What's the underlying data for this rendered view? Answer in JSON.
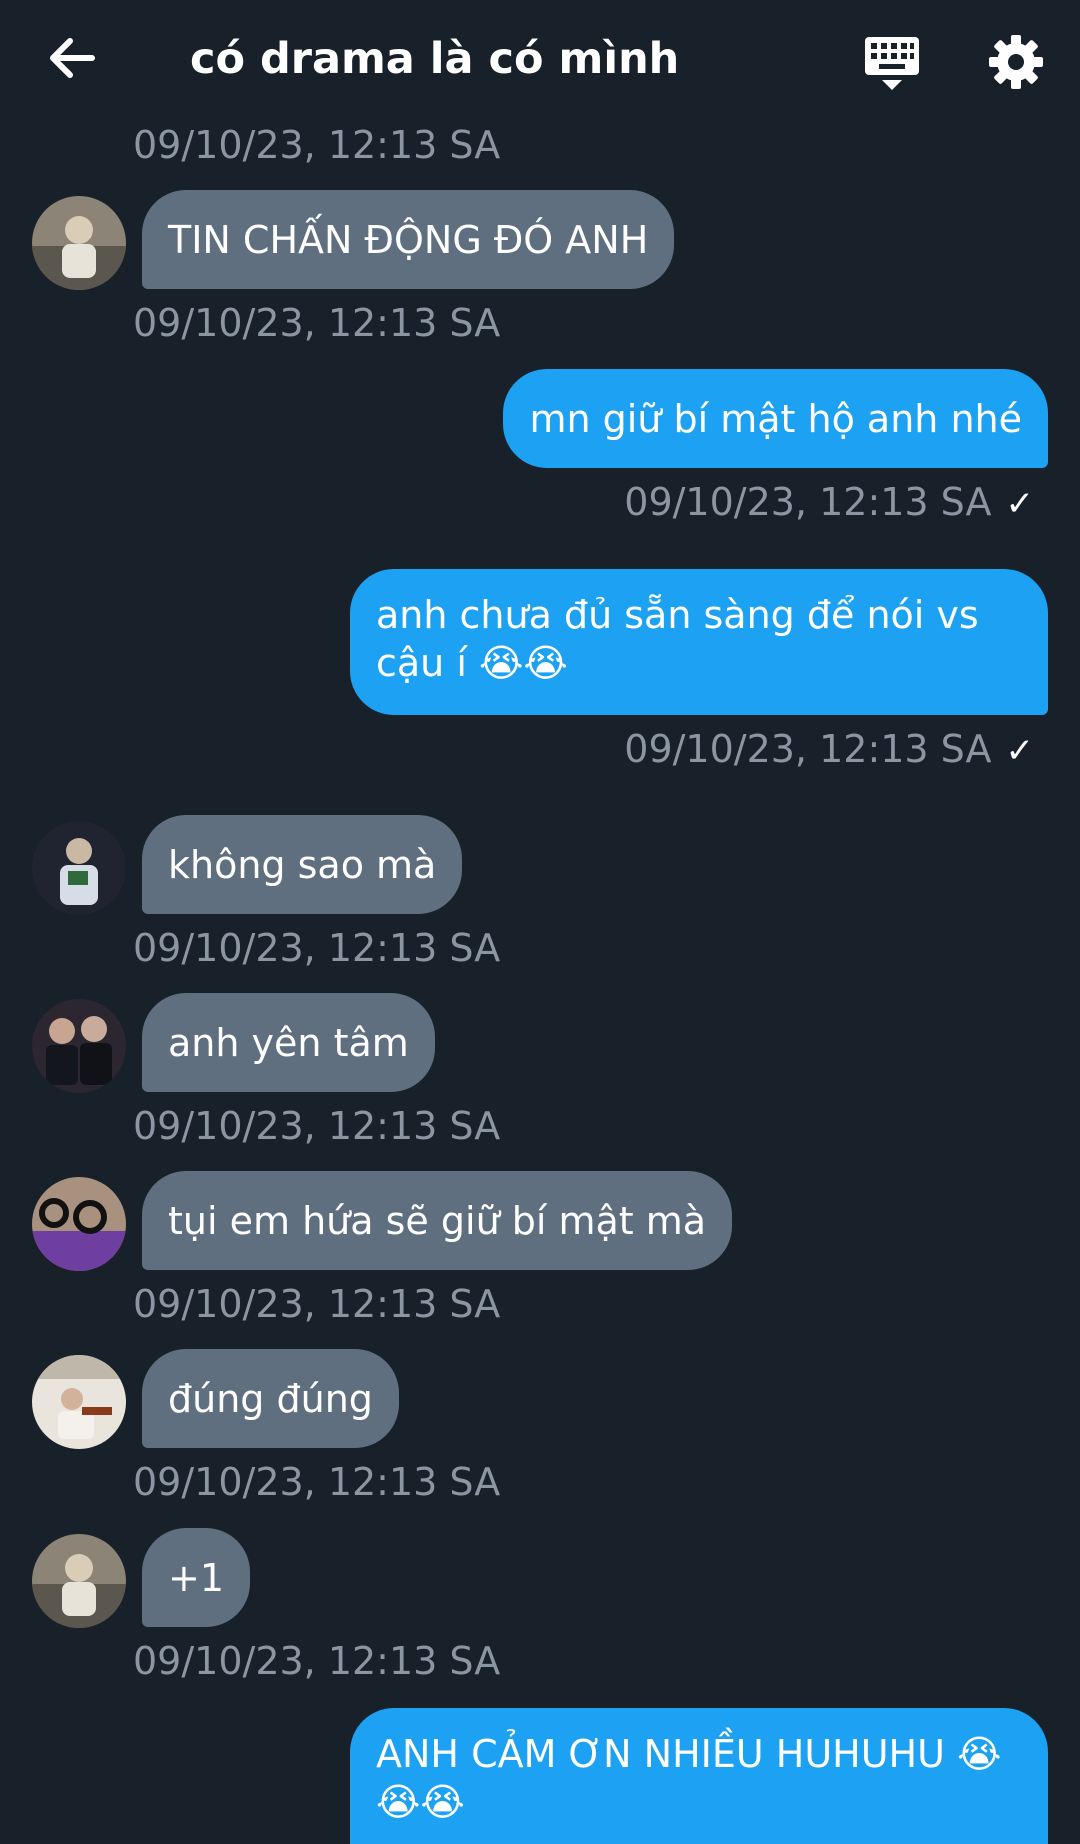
{
  "header": {
    "title": "có drama là có mình",
    "back_icon": "arrow-left-icon",
    "keyboard_icon": "keyboard-icon",
    "settings_icon": "gear-icon"
  },
  "colors": {
    "background": "#18202a",
    "incoming_bubble": "#5f6f80",
    "outgoing_bubble": "#1da1f2",
    "timestamp": "#8b96a3"
  },
  "messages": [
    {
      "text": "TIN CHẤN ĐỘNG ĐÓ ANH",
      "timestamp": "09/10/23, 12:13 SA"
    },
    {
      "text": "mn giữ bí mật hộ anh nhé",
      "timestamp": "09/10/23, 12:13 SA"
    },
    {
      "text": "anh chưa đủ sẵn sàng để nói vs cậu í 😭😭",
      "timestamp": "09/10/23, 12:13 SA"
    },
    {
      "text": "không sao mà",
      "timestamp": "09/10/23, 12:13 SA"
    },
    {
      "text": "anh yên tâm",
      "timestamp": "09/10/23, 12:13 SA"
    },
    {
      "text": "tụi em hứa sẽ giữ bí mật mà",
      "timestamp": "09/10/23, 12:13 SA"
    },
    {
      "text": "đúng đúng",
      "timestamp": "09/10/23, 12:13 SA"
    },
    {
      "text": "+1",
      "timestamp": "09/10/23, 12:13 SA"
    },
    {
      "text": "ANH CẢM ƠN NHIỀU HUHUHU 😭😭😭"
    }
  ],
  "partial_top_timestamp": "09/10/23, 12:13 SA",
  "read_mark": "✓"
}
